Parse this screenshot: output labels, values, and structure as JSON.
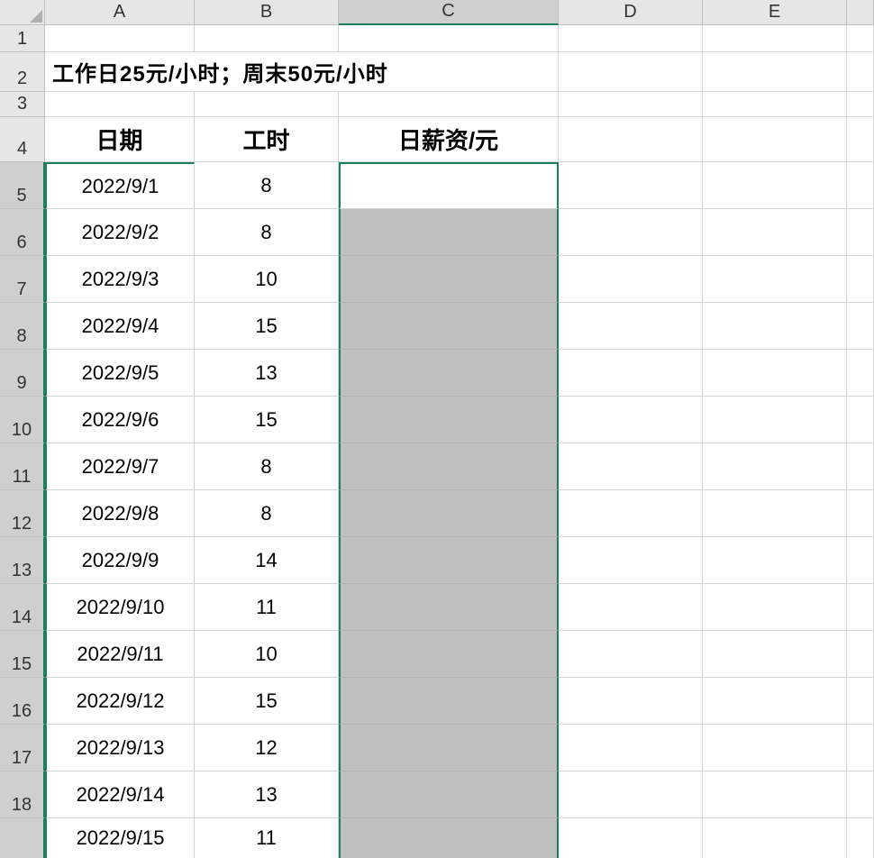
{
  "columns": [
    "A",
    "B",
    "C",
    "D",
    "E"
  ],
  "rowNumbers": [
    1,
    2,
    3,
    4,
    5,
    6,
    7,
    8,
    9,
    10,
    11,
    12,
    13,
    14,
    15,
    16,
    17,
    18
  ],
  "description": "工作日25元/小时；周末50元/小时",
  "headers": {
    "A": "日期",
    "B": "工时",
    "C": "日薪资/元"
  },
  "rows": [
    {
      "date": "2022/9/1",
      "hours": "8"
    },
    {
      "date": "2022/9/2",
      "hours": "8"
    },
    {
      "date": "2022/9/3",
      "hours": "10"
    },
    {
      "date": "2022/9/4",
      "hours": "15"
    },
    {
      "date": "2022/9/5",
      "hours": "13"
    },
    {
      "date": "2022/9/6",
      "hours": "15"
    },
    {
      "date": "2022/9/7",
      "hours": "8"
    },
    {
      "date": "2022/9/8",
      "hours": "8"
    },
    {
      "date": "2022/9/9",
      "hours": "14"
    },
    {
      "date": "2022/9/10",
      "hours": "11"
    },
    {
      "date": "2022/9/11",
      "hours": "10"
    },
    {
      "date": "2022/9/12",
      "hours": "15"
    },
    {
      "date": "2022/9/13",
      "hours": "12"
    },
    {
      "date": "2022/9/14",
      "hours": "13"
    },
    {
      "date": "2022/9/15",
      "hours": "11"
    }
  ],
  "selection": {
    "column": "C",
    "activeRow": 5,
    "startRow": 5,
    "endRow": 18
  }
}
